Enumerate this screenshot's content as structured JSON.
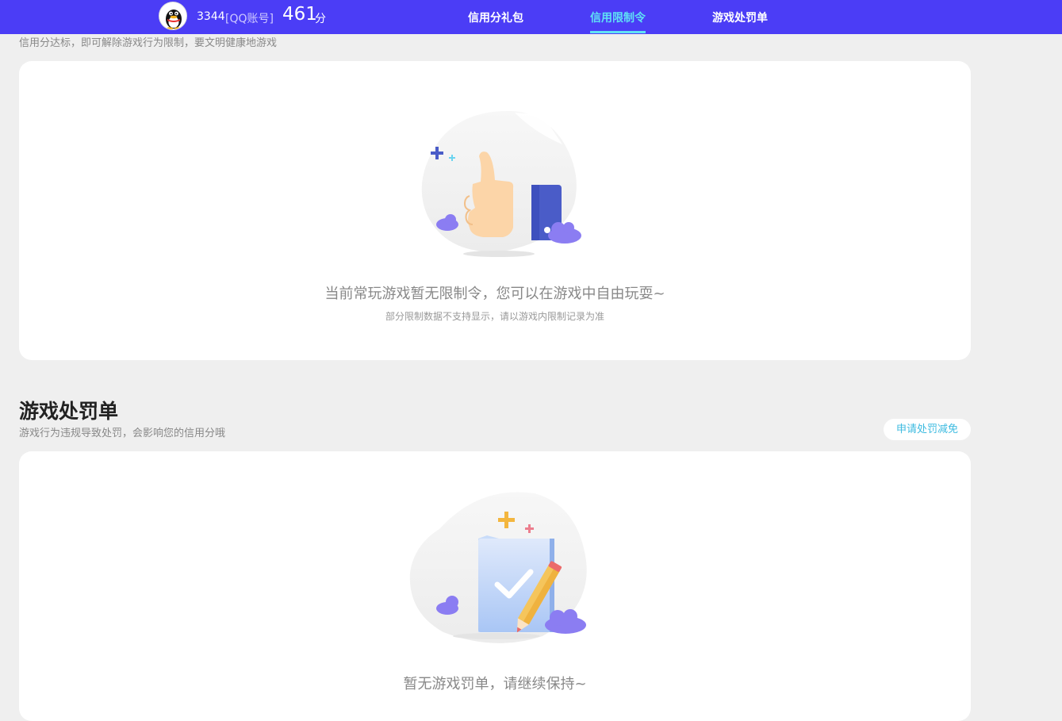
{
  "header": {
    "account_id": "3344",
    "account_type": "[QQ账号]",
    "score": "461",
    "score_unit": "分",
    "nav": [
      {
        "label": "信用分礼包",
        "active": false
      },
      {
        "label": "信用限制令",
        "active": true
      },
      {
        "label": "游戏处罚单",
        "active": false
      }
    ],
    "colors": {
      "bar": "#4b3df6",
      "active": "#5fe1f5"
    }
  },
  "restriction_section": {
    "subtitle": "信用分达标，即可解除游戏行为限制，要文明健康地游戏",
    "empty_title": "当前常玩游戏暂无限制令，您可以在游戏中自由玩耍~",
    "empty_note": "部分限制数据不支持显示，请以游戏内限制记录为准",
    "illustration": "thumbs-up-icon"
  },
  "penalty_section": {
    "title": "游戏处罚单",
    "subtitle": "游戏行为违规导致处罚，会影响您的信用分哦",
    "apply_button": "申请处罚减免",
    "empty_title": "暂无游戏罚单，请继续保持~",
    "illustration": "checklist-pencil-icon"
  }
}
